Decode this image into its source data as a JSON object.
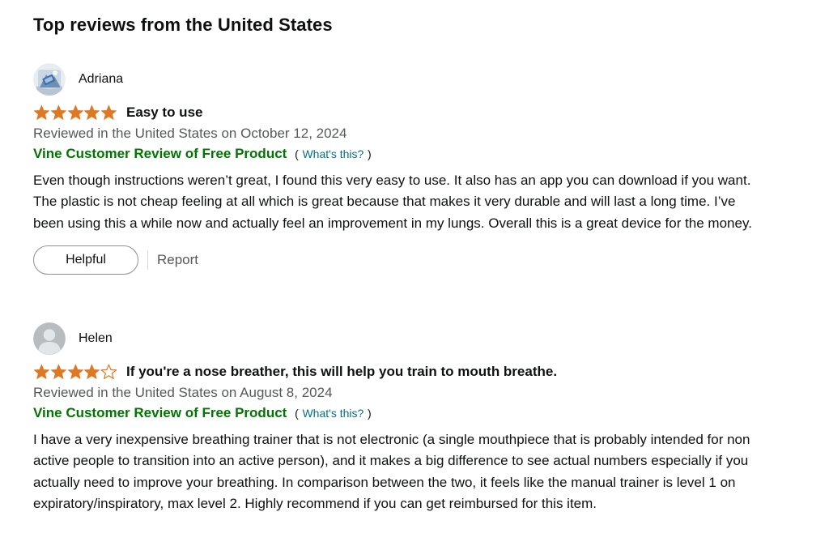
{
  "section": {
    "title": "Top reviews from the United States"
  },
  "reviews": [
    {
      "profile_name": "Adriana",
      "avatar_icon": "profile-photo-avatar",
      "rating": 5,
      "rating_max": 5,
      "title": "Easy to use",
      "date": "Reviewed in the United States on October 12, 2024",
      "vine_badge": "Vine Customer Review of Free Product",
      "vine_paren_open": "(",
      "vine_link": "What's this?",
      "vine_paren_close": ")",
      "body": "Even though instructions weren’t great, I found this very easy to use. It also has an app you can download if you want. The plastic is not cheap feeling at all which is great because that makes it very durable and will last a long time. I’ve been using this a while now and actually feel an improvement in my lungs. Overall this is a great device for the money.",
      "helpful_label": "Helpful",
      "report_label": "Report"
    },
    {
      "profile_name": "Helen",
      "avatar_icon": "default-user-avatar",
      "rating": 4,
      "rating_max": 5,
      "title": "If you're a nose breather, this will help you train to mouth breathe.",
      "date": "Reviewed in the United States on August 8, 2024",
      "vine_badge": "Vine Customer Review of Free Product",
      "vine_paren_open": "(",
      "vine_link": "What's this?",
      "vine_paren_close": ")",
      "body": "I have a very inexpensive breathing trainer that is not electronic (a single mouthpiece that is probably intended for non active people to transition into an active person), and it makes a big difference to see actual numbers especially if you actually need to improve your breathing. In comparison between the two, it feels like the manual trainer is level 1 on expiratory/inspiratory, max level 2. Highly recommend if you can get reimbursed for this item."
    }
  ],
  "colors": {
    "star_filled": "#de7921",
    "star_outline": "#de7921",
    "vine_green": "#007600",
    "link_teal": "#007185",
    "secondary_text": "#565959"
  }
}
